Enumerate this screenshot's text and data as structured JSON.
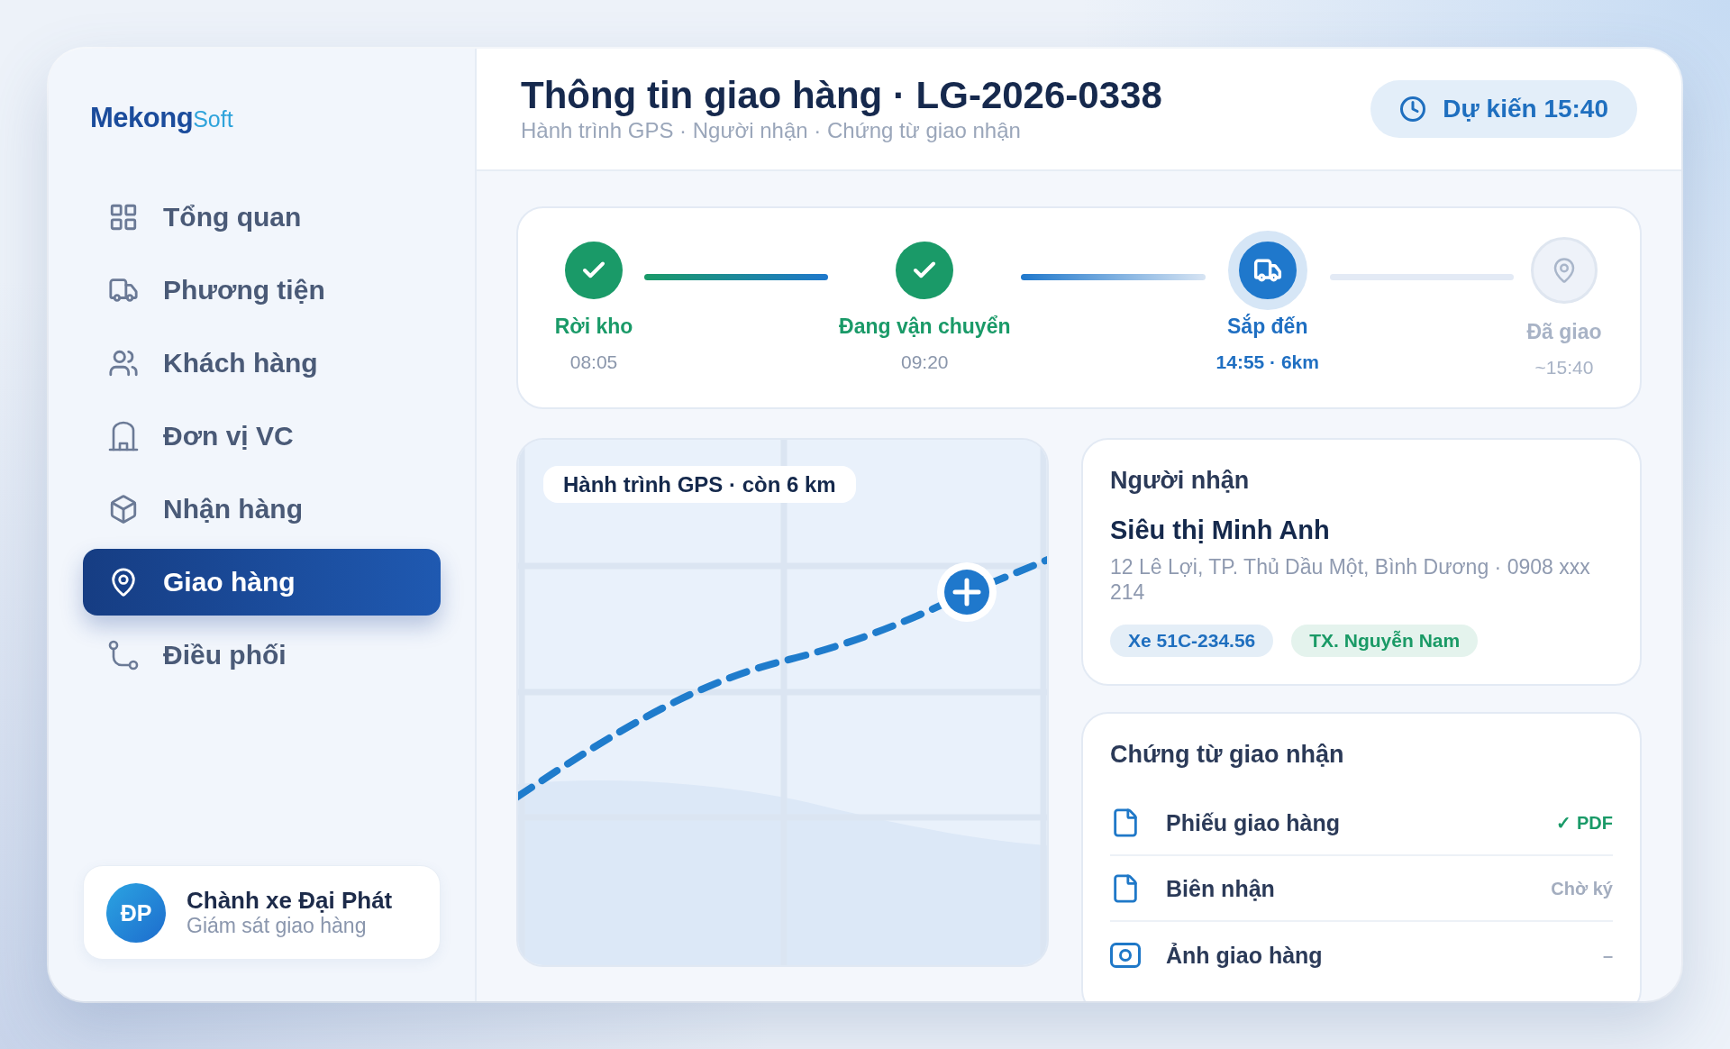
{
  "sidebar": {
    "logo": {
      "name": "Mekong",
      "suffix": "Soft"
    },
    "items": [
      {
        "label": "Tổng quan",
        "selected": false
      },
      {
        "label": "Phương tiện",
        "selected": false
      },
      {
        "label": "Khách hàng",
        "selected": false
      },
      {
        "label": "Đơn vị VC",
        "selected": false
      },
      {
        "label": "Nhận hàng",
        "selected": false
      },
      {
        "label": "Giao hàng",
        "selected": true
      },
      {
        "label": "Điều phối",
        "selected": false
      }
    ],
    "user": {
      "initials": "ĐP",
      "name": "Chành xe Đại Phát",
      "role": "Giám sát giao hàng"
    }
  },
  "header": {
    "title": "Thông tin giao hàng · LG-2026-0338",
    "subtitle": "Hành trình GPS · Người nhận · Chứng từ giao nhận",
    "eta": "Dự kiến 15:40"
  },
  "steps": [
    {
      "label": "Rời kho",
      "time": "08:05",
      "completed": true,
      "current": false
    },
    {
      "label": "Đang vận chuyển",
      "time": "09:20",
      "completed": true,
      "current": false
    },
    {
      "label": "Sắp đến",
      "time": "14:55 · 6km",
      "completed": false,
      "current": true
    },
    {
      "label": "Đã giao",
      "time": "~15:40",
      "completed": false,
      "current": false
    }
  ],
  "map": {
    "label": "Hành trình GPS · còn 6 km"
  },
  "recipient": {
    "heading": "Người nhận",
    "name": "Siêu thị Minh Anh",
    "address": "12 Lê Lợi, TP. Thủ Dầu Một, Bình Dương · 0908 xxx 214",
    "tags": [
      {
        "label": "Xe 51C-234.56",
        "color": "#1f6fbf"
      },
      {
        "label": "TX. Nguyễn Nam",
        "color": "#1a9a66"
      }
    ]
  },
  "documents": {
    "heading": "Chứng từ giao nhận",
    "items": [
      {
        "kind": "file",
        "name": "Phiếu giao hàng",
        "status": "✓ PDF",
        "completed": true
      },
      {
        "kind": "file",
        "name": "Biên nhận",
        "status": "Chờ ký",
        "completed": false
      },
      {
        "kind": "photo",
        "name": "Ảnh giao hàng",
        "status": "–",
        "completed": false
      }
    ]
  }
}
